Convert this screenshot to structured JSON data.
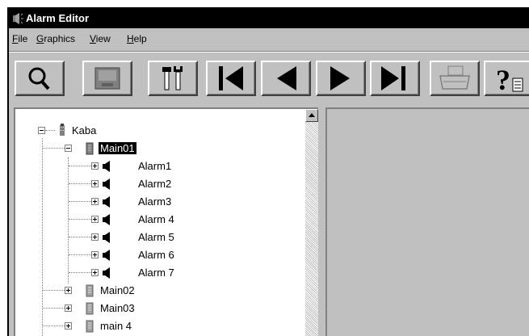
{
  "window": {
    "title": "Alarm Editor"
  },
  "menu": [
    {
      "label": "File",
      "hotkey": "F",
      "rest": "ile"
    },
    {
      "label": "Graphics",
      "hotkey": "G",
      "rest": "raphics"
    },
    {
      "label": "View",
      "hotkey": "V",
      "rest": "iew"
    },
    {
      "label": "Help",
      "hotkey": "H",
      "rest": "elp"
    }
  ],
  "toolbar": {
    "buttons": [
      {
        "name": "search",
        "icon": "magnifier-icon"
      },
      {
        "name": "save",
        "icon": "monitor-icon"
      },
      {
        "name": "tools",
        "icon": "tools-icon"
      },
      {
        "name": "first",
        "icon": "first-record-icon"
      },
      {
        "name": "previous",
        "icon": "previous-record-icon"
      },
      {
        "name": "next",
        "icon": "next-record-icon"
      },
      {
        "name": "last",
        "icon": "last-record-icon"
      },
      {
        "name": "print",
        "icon": "printer-icon"
      },
      {
        "name": "help",
        "icon": "help-icon"
      }
    ]
  },
  "tree": {
    "root": {
      "label": "Kaba"
    },
    "nodes": [
      {
        "label": "Main01",
        "selected": true,
        "expanded": true,
        "children": [
          "Alarm1",
          "Alarm2",
          "Alarm3",
          "Alarm 4",
          "Alarm 5",
          "Alarm 6",
          "Alarm 7"
        ]
      },
      {
        "label": "Main02",
        "expanded": false
      },
      {
        "label": "Main03",
        "expanded": false
      },
      {
        "label": "main 4",
        "expanded": false
      }
    ]
  }
}
